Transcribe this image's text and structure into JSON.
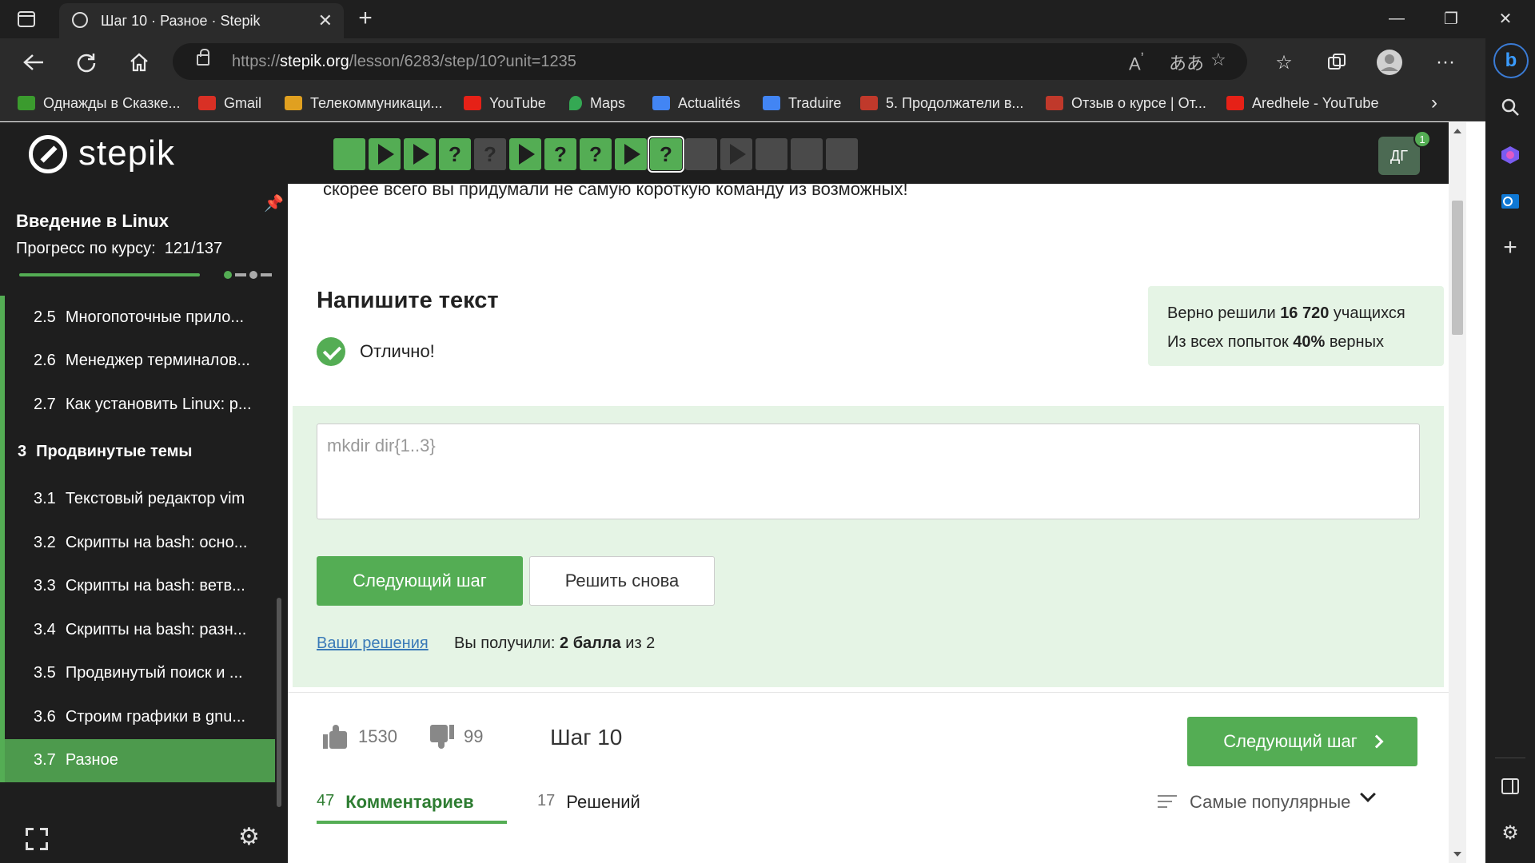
{
  "browser": {
    "tab_title": "Шаг 10 · Разное · Stepik",
    "url_prefix": "https://",
    "url_host": "stepik.org",
    "url_path": "/lesson/6283/step/10?unit=1235",
    "bookmarks": [
      {
        "label": "Однажды в Сказке...",
        "color": "#3b9b2e"
      },
      {
        "label": "Gmail",
        "color": "#d93025"
      },
      {
        "label": "Телекоммуникаци...",
        "color": "#e0a020"
      },
      {
        "label": "YouTube",
        "color": "#e62117"
      },
      {
        "label": "Maps",
        "color": "#34a853"
      },
      {
        "label": "Actualités",
        "color": "#4285f4"
      },
      {
        "label": "Traduire",
        "color": "#4285f4"
      },
      {
        "label": "5. Продолжатели в...",
        "color": "#c0392b"
      },
      {
        "label": "Отзыв о курсе | От...",
        "color": "#c0392b"
      },
      {
        "label": "Aredhele - YouTube",
        "color": "#e62117"
      }
    ]
  },
  "header": {
    "logo": "stepik",
    "avatar": "ДГ",
    "badge": "1",
    "steps": [
      {
        "kind": "text",
        "state": "done"
      },
      {
        "kind": "code",
        "state": "done"
      },
      {
        "kind": "code",
        "state": "done"
      },
      {
        "kind": "quiz",
        "state": "done"
      },
      {
        "kind": "quiz",
        "state": "todo"
      },
      {
        "kind": "code",
        "state": "done"
      },
      {
        "kind": "quiz",
        "state": "done"
      },
      {
        "kind": "quiz",
        "state": "done"
      },
      {
        "kind": "code",
        "state": "done"
      },
      {
        "kind": "quiz",
        "state": "done",
        "current": true
      },
      {
        "kind": "text",
        "state": "todo"
      },
      {
        "kind": "code",
        "state": "todo"
      },
      {
        "kind": "text",
        "state": "todo"
      },
      {
        "kind": "text",
        "state": "todo"
      },
      {
        "kind": "text",
        "state": "todo"
      }
    ]
  },
  "sidebar": {
    "course_title": "Введение в Linux",
    "progress_label": "Прогресс по курсу:",
    "progress_value": "121/137",
    "progress_fraction": 0.883,
    "lessons": [
      {
        "num": "2.5",
        "label": "Многопоточные прило..."
      },
      {
        "num": "2.6",
        "label": "Менеджер терминалов..."
      },
      {
        "num": "2.7",
        "label": "Как установить Linux: р..."
      },
      {
        "num": "3",
        "label": "Продвинутые темы",
        "module": true
      },
      {
        "num": "3.1",
        "label": "Текстовый редактор vim"
      },
      {
        "num": "3.2",
        "label": "Скрипты на bash: осно..."
      },
      {
        "num": "3.3",
        "label": "Скрипты на bash: ветв..."
      },
      {
        "num": "3.4",
        "label": "Скрипты на bash: разн..."
      },
      {
        "num": "3.5",
        "label": "Продвинутый поиск и ..."
      },
      {
        "num": "3.6",
        "label": "Строим графики в gnu..."
      },
      {
        "num": "3.7",
        "label": "Разное",
        "active": true
      }
    ]
  },
  "main": {
    "cut_text": "скорее всего вы придумали не самую короткую команду из возможных!",
    "task_title": "Напишите текст",
    "status": "Отлично!",
    "stats_line1_prefix": "Верно решили",
    "stats_line1_value": "16 720",
    "stats_line1_suffix": "учащихся",
    "stats_line2_prefix": "Из всех попыток",
    "stats_line2_value": "40%",
    "stats_line2_suffix": "верных",
    "answer": "mkdir dir{1..3}",
    "next_button": "Следующий шаг",
    "retry_button": "Решить снова",
    "your_solutions": "Ваши решения",
    "score_prefix": "Вы получили:",
    "score_value": "2 балла",
    "score_suffix": "из 2",
    "likes": "1530",
    "dislikes": "99",
    "step_label": "Шаг 10",
    "next_button_2": "Следующий шаг",
    "comments_count": "47",
    "comments_label": "Комментариев",
    "solutions_count": "17",
    "solutions_label": "Решений",
    "sort_label": "Самые популярные"
  }
}
